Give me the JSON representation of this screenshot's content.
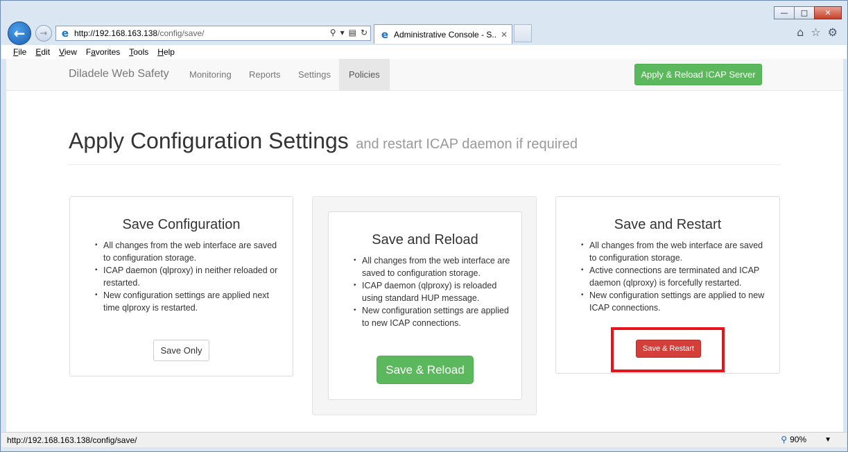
{
  "browser": {
    "url_host": "http://192.168.163.138",
    "url_path": "/config/save/",
    "tab_title": "Administrative Console - S...",
    "menu": [
      {
        "key": "F",
        "rest": "ile"
      },
      {
        "key": "E",
        "rest": "dit"
      },
      {
        "key": "V",
        "rest": "iew"
      },
      {
        "key": "",
        "rest": "Favorites",
        "prefix": "F",
        "label": "Favorites"
      },
      {
        "key": "T",
        "rest": "ools"
      },
      {
        "key": "H",
        "rest": "elp"
      }
    ],
    "status_url": "http://192.168.163.138/config/save/",
    "zoom": "90%"
  },
  "navbar": {
    "brand": "Diladele Web Safety",
    "links": [
      "Monitoring",
      "Reports",
      "Settings",
      "Policies"
    ],
    "active": "Policies",
    "apply_button": "Apply & Reload ICAP Server"
  },
  "header": {
    "title": "Apply Configuration Settings",
    "subtitle": "and restart ICAP daemon if required"
  },
  "panels": [
    {
      "title": "Save Configuration",
      "items": [
        "All changes from the web interface are saved to configuration storage.",
        "ICAP daemon (qlproxy) in neither reloaded or restarted.",
        "New configuration settings are applied next time qlproxy is restarted."
      ],
      "button": "Save Only"
    },
    {
      "title": "Save and Reload",
      "items": [
        "All changes from the web interface are saved to configuration storage.",
        "ICAP daemon (qlproxy) is reloaded using standard HUP message.",
        "New configuration settings are applied to new ICAP connections."
      ],
      "button": "Save & Reload"
    },
    {
      "title": "Save and Restart",
      "items": [
        "All changes from the web interface are saved to configuration storage.",
        "Active connections are terminated and ICAP daemon (qlproxy) is forcefully restarted.",
        "New configuration settings are applied to new ICAP connections."
      ],
      "button": "Save & Restart"
    }
  ],
  "colors": {
    "success": "#5cb85c",
    "danger": "#d43f3a",
    "highlight": "#e8141b"
  }
}
